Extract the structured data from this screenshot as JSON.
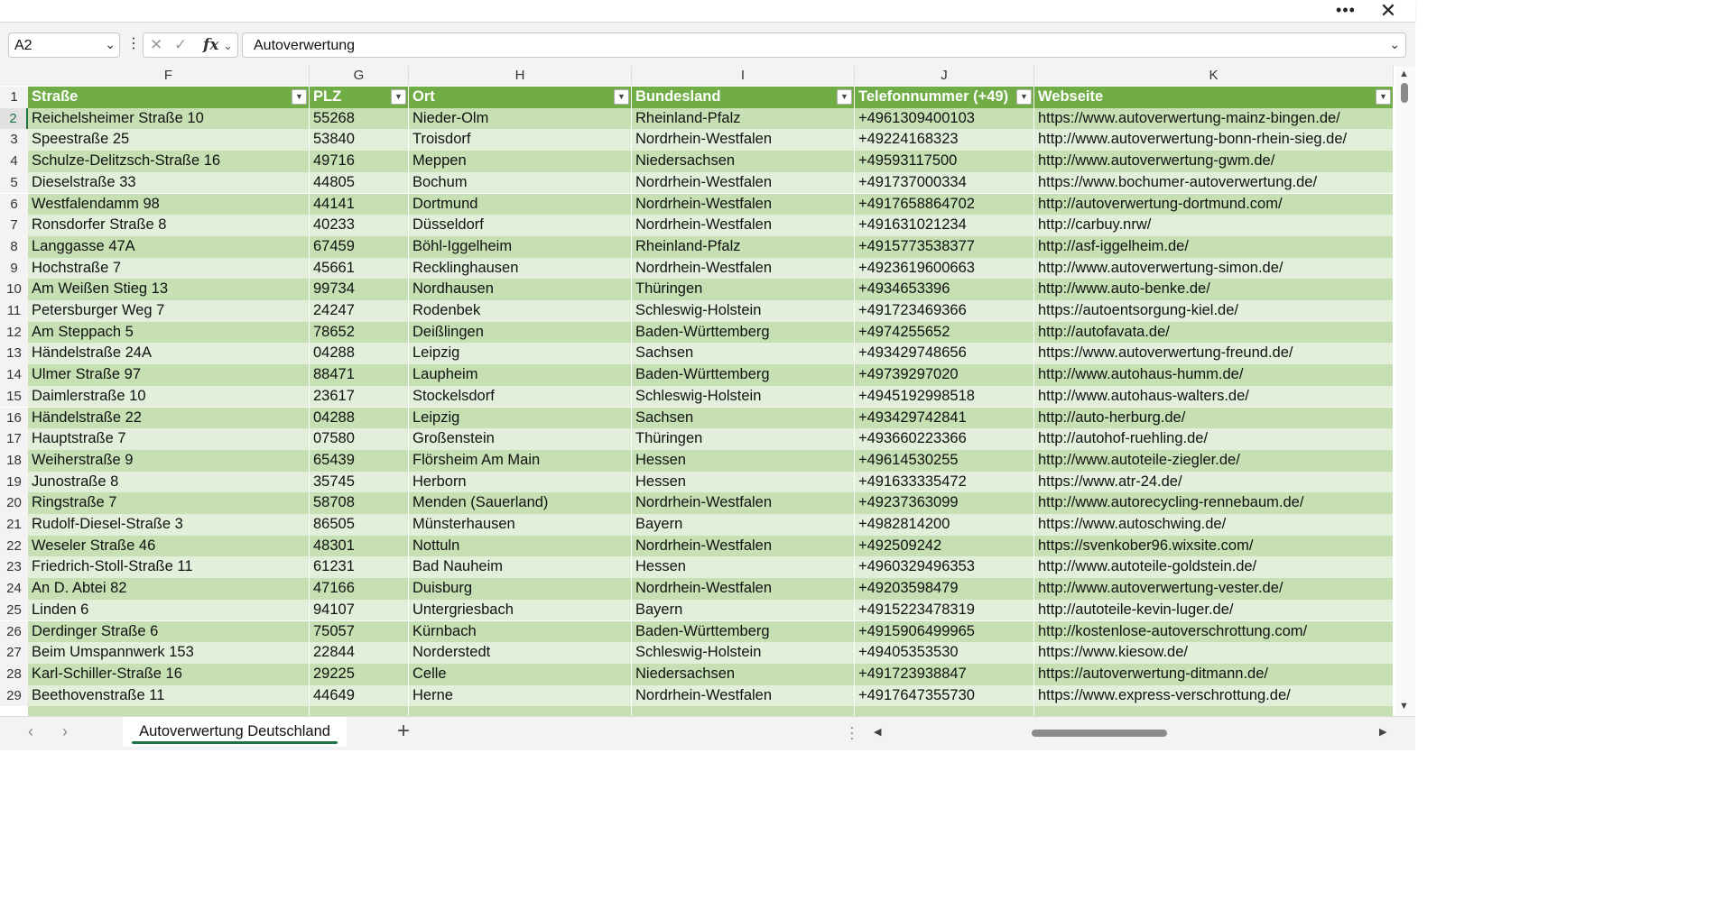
{
  "window": {
    "more_icon": "ellipsis-icon",
    "close_icon": "close-icon"
  },
  "formula_bar": {
    "name_box": "A2",
    "formula_value": "Autoverwertung",
    "fx_label": "fx"
  },
  "columns": [
    "F",
    "G",
    "H",
    "I",
    "J",
    "K"
  ],
  "table": {
    "headers": [
      "Straße",
      "PLZ",
      "Ort",
      "Bundesland",
      "Telefonnummer (+49)",
      "Webseite"
    ],
    "rows": [
      [
        "2",
        "Reichelsheimer Straße 10",
        "55268",
        "Nieder-Olm",
        "Rheinland-Pfalz",
        "+4961309400103",
        "https://www.autoverwertung-mainz-bingen.de/"
      ],
      [
        "3",
        "Speestraße 25",
        "53840",
        "Troisdorf",
        "Nordrhein-Westfalen",
        "+49224168323",
        "http://www.autoverwertung-bonn-rhein-sieg.de/"
      ],
      [
        "4",
        "Schulze-Delitzsch-Straße 16",
        "49716",
        "Meppen",
        "Niedersachsen",
        "+49593117500",
        "http://www.autoverwertung-gwm.de/"
      ],
      [
        "5",
        "Dieselstraße 33",
        "44805",
        "Bochum",
        "Nordrhein-Westfalen",
        "+491737000334",
        "https://www.bochumer-autoverwertung.de/"
      ],
      [
        "6",
        "Westfalendamm 98",
        "44141",
        "Dortmund",
        "Nordrhein-Westfalen",
        "+4917658864702",
        "http://autoverwertung-dortmund.com/"
      ],
      [
        "7",
        "Ronsdorfer Straße 8",
        "40233",
        "Düsseldorf",
        "Nordrhein-Westfalen",
        "+491631021234",
        "http://carbuy.nrw/"
      ],
      [
        "8",
        "Langgasse 47A",
        "67459",
        "Böhl-Iggelheim",
        "Rheinland-Pfalz",
        "+4915773538377",
        "http://asf-iggelheim.de/"
      ],
      [
        "9",
        "Hochstraße 7",
        "45661",
        "Recklinghausen",
        "Nordrhein-Westfalen",
        "+4923619600663",
        "http://www.autoverwertung-simon.de/"
      ],
      [
        "10",
        "Am Weißen Stieg 13",
        "99734",
        "Nordhausen",
        "Thüringen",
        "+4934653396",
        "http://www.auto-benke.de/"
      ],
      [
        "11",
        "Petersburger Weg 7",
        "24247",
        "Rodenbek",
        "Schleswig-Holstein",
        "+491723469366",
        "https://autoentsorgung-kiel.de/"
      ],
      [
        "12",
        "Am Steppach 5",
        "78652",
        "Deißlingen",
        "Baden-Württemberg",
        "+4974255652",
        "http://autofavata.de/"
      ],
      [
        "13",
        "Händelstraße 24A",
        "04288",
        "Leipzig",
        "Sachsen",
        "+493429748656",
        "https://www.autoverwertung-freund.de/"
      ],
      [
        "14",
        "Ulmer Straße 97",
        "88471",
        "Laupheim",
        "Baden-Württemberg",
        "+49739297020",
        "http://www.autohaus-humm.de/"
      ],
      [
        "15",
        "Daimlerstraße 10",
        "23617",
        "Stockelsdorf",
        "Schleswig-Holstein",
        "+4945192998518",
        "http://www.autohaus-walters.de/"
      ],
      [
        "16",
        "Händelstraße 22",
        "04288",
        "Leipzig",
        "Sachsen",
        "+493429742841",
        "http://auto-herburg.de/"
      ],
      [
        "17",
        "Hauptstraße 7",
        "07580",
        "Großenstein",
        "Thüringen",
        "+493660223366",
        "http://autohof-ruehling.de/"
      ],
      [
        "18",
        "Weiherstraße 9",
        "65439",
        "Flörsheim Am Main",
        "Hessen",
        "+49614530255",
        "http://www.autoteile-ziegler.de/"
      ],
      [
        "19",
        "Junostraße 8",
        "35745",
        "Herborn",
        "Hessen",
        "+491633335472",
        "https://www.atr-24.de/"
      ],
      [
        "20",
        "Ringstraße 7",
        "58708",
        "Menden (Sauerland)",
        "Nordrhein-Westfalen",
        "+49237363099",
        "http://www.autorecycling-rennebaum.de/"
      ],
      [
        "21",
        "Rudolf-Diesel-Straße 3",
        "86505",
        "Münsterhausen",
        "Bayern",
        "+4982814200",
        "https://www.autoschwing.de/"
      ],
      [
        "22",
        "Weseler Straße 46",
        "48301",
        "Nottuln",
        "Nordrhein-Westfalen",
        "+492509242",
        "https://svenkober96.wixsite.com/"
      ],
      [
        "23",
        "Friedrich-Stoll-Straße 11",
        "61231",
        "Bad Nauheim",
        "Hessen",
        "+4960329496353",
        "http://www.autoteile-goldstein.de/"
      ],
      [
        "24",
        "An D. Abtei 82",
        "47166",
        "Duisburg",
        "Nordrhein-Westfalen",
        "+49203598479",
        "http://www.autoverwertung-vester.de/"
      ],
      [
        "25",
        "Linden 6",
        "94107",
        "Untergriesbach",
        "Bayern",
        "+4915223478319",
        "http://autoteile-kevin-luger.de/"
      ],
      [
        "26",
        "Derdinger Straße 6",
        "75057",
        "Kürnbach",
        "Baden-Württemberg",
        "+4915906499965",
        "http://kostenlose-autoverschrottung.com/"
      ],
      [
        "27",
        "Beim Umspannwerk 153",
        "22844",
        "Norderstedt",
        "Schleswig-Holstein",
        "+49405353530",
        "https://www.kiesow.de/"
      ],
      [
        "28",
        "Karl-Schiller-Straße 16",
        "29225",
        "Celle",
        "Niedersachsen",
        "+491723938847",
        "https://autoverwertung-ditmann.de/"
      ],
      [
        "29",
        "Beethovenstraße 11",
        "44649",
        "Herne",
        "Nordrhein-Westfalen",
        "+4917647355730",
        "https://www.express-verschrottung.de/"
      ]
    ]
  },
  "sheet_tabs": {
    "active": "Autoverwertung Deutschland"
  },
  "colors": {
    "header_green": "#70ad47",
    "band_dark": "#c6e0b4",
    "band_light": "#e2efda",
    "accent": "#217346"
  }
}
